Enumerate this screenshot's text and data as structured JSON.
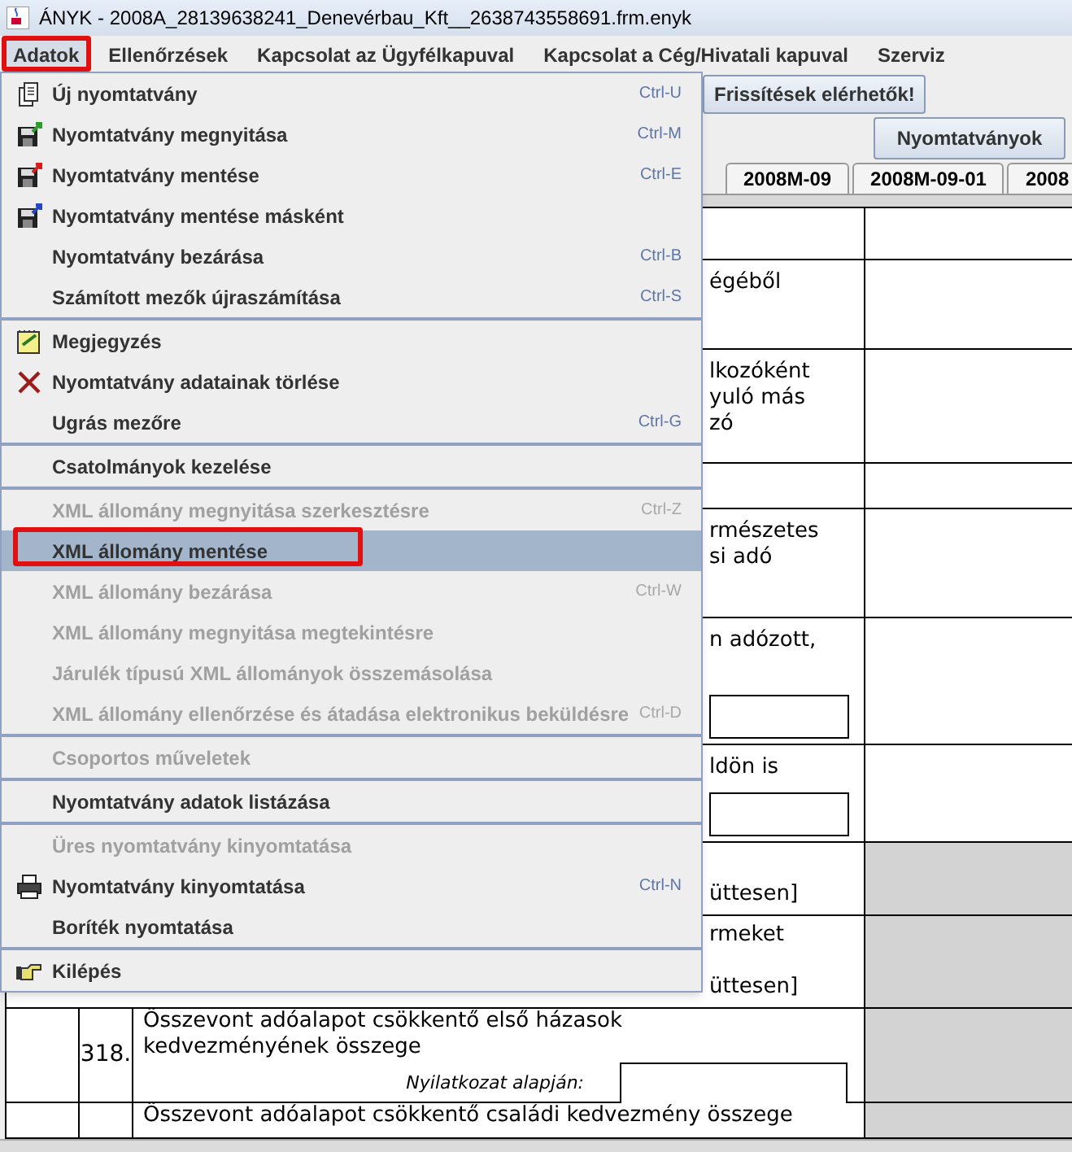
{
  "window": {
    "title": "ÁNYK - 2008A_28139638241_Denevérbau_Kft__2638743558691.frm.enyk"
  },
  "menu_bar": [
    {
      "label": "Adatok",
      "selected": true,
      "marked": true
    },
    {
      "label": "Ellenőrzések",
      "selected": false,
      "marked": false
    },
    {
      "label": "Kapcsolat az Ügyfélkapuval",
      "selected": false,
      "marked": false
    },
    {
      "label": "Kapcsolat a Cég/Hivatali kapuval",
      "selected": false,
      "marked": false
    },
    {
      "label": "Szerviz",
      "selected": false,
      "marked": false
    }
  ],
  "menu": {
    "groups": [
      {
        "items": [
          {
            "label": "Új nyomtatvány",
            "shortcut": "Ctrl-U",
            "kind": "new",
            "disabled": false,
            "selected": false,
            "marked": false
          },
          {
            "label": "Nyomtatvány megnyitása",
            "shortcut": "Ctrl-M",
            "kind": "open",
            "disabled": false,
            "selected": false,
            "marked": false
          },
          {
            "label": "Nyomtatvány mentése",
            "shortcut": "Ctrl-E",
            "kind": "save",
            "disabled": false,
            "selected": false,
            "marked": false
          },
          {
            "label": "Nyomtatvány mentése másként",
            "kind": "saveas",
            "disabled": false,
            "selected": false,
            "marked": false
          },
          {
            "label": "Nyomtatvány bezárása",
            "shortcut": "Ctrl-B",
            "disabled": false,
            "selected": false,
            "marked": false
          },
          {
            "label": "Számított mezők újraszámítása",
            "shortcut": "Ctrl-S",
            "disabled": false,
            "selected": false,
            "marked": false
          }
        ]
      },
      {
        "items": [
          {
            "label": "Megjegyzés",
            "kind": "note",
            "disabled": false,
            "selected": false,
            "marked": false
          },
          {
            "label": "Nyomtatvány adatainak törlése",
            "kind": "delete",
            "disabled": false,
            "selected": false,
            "marked": false
          },
          {
            "label": "Ugrás mezőre",
            "shortcut": "Ctrl-G",
            "disabled": false,
            "selected": false,
            "marked": false
          }
        ]
      },
      {
        "items": [
          {
            "label": "Csatolmányok kezelése",
            "disabled": false,
            "selected": false,
            "marked": false
          }
        ]
      },
      {
        "items": [
          {
            "label": "XML állomány megnyitása szerkesztésre",
            "shortcut": "Ctrl-Z",
            "disabled": true,
            "selected": false,
            "marked": false
          },
          {
            "label": "XML állomány mentése",
            "disabled": false,
            "selected": true,
            "marked": true
          },
          {
            "label": "XML állomány bezárása",
            "shortcut": "Ctrl-W",
            "disabled": true,
            "selected": false,
            "marked": false
          },
          {
            "label": "XML állomány megnyitása megtekintésre",
            "disabled": true,
            "selected": false,
            "marked": false
          },
          {
            "label": "Járulék típusú XML állományok összemásolása",
            "disabled": true,
            "selected": false,
            "marked": false
          },
          {
            "label": "XML állomány ellenőrzése és átadása elektronikus beküldésre",
            "shortcut": "Ctrl-D",
            "disabled": true,
            "selected": false,
            "marked": false
          }
        ]
      },
      {
        "items": [
          {
            "label": "Csoportos műveletek",
            "disabled": true,
            "selected": false,
            "marked": false
          }
        ]
      },
      {
        "items": [
          {
            "label": "Nyomtatvány adatok listázása",
            "disabled": false,
            "selected": false,
            "marked": false
          }
        ]
      },
      {
        "items": [
          {
            "label": "Üres nyomtatvány kinyomtatása",
            "disabled": true,
            "selected": false,
            "marked": false
          },
          {
            "label": "Nyomtatvány kinyomtatása",
            "shortcut": "Ctrl-N",
            "kind": "print",
            "disabled": false,
            "selected": false,
            "marked": false
          },
          {
            "label": "Boríték nyomtatása",
            "disabled": false,
            "selected": false,
            "marked": false
          }
        ]
      },
      {
        "items": [
          {
            "label": "Kilépés",
            "kind": "exit",
            "disabled": false,
            "selected": false,
            "marked": false
          }
        ]
      }
    ]
  },
  "toolbar": {
    "update_button": "Frissítések elérhetők!",
    "forms_button": "Nyomtatványok"
  },
  "tabs": [
    {
      "label": "2008M-09"
    },
    {
      "label": "2008M-09-01"
    },
    {
      "label": "2008"
    }
  ],
  "form": {
    "rows": [
      {
        "kind": "fragment",
        "shaded": false,
        "has_input": false
      },
      {
        "kind": "fragment",
        "lines": [
          "égéből"
        ],
        "shaded": false,
        "has_input": false
      },
      {
        "kind": "fragment",
        "lines": [
          "lkozóként",
          "yuló más",
          "zó"
        ],
        "shaded": false,
        "has_input": false
      },
      {
        "kind": "fragment",
        "shaded": false,
        "has_input": false
      },
      {
        "kind": "fragment",
        "lines": [
          "rmészetes",
          "si adó"
        ],
        "shaded": false,
        "has_input": false
      },
      {
        "kind": "fragment",
        "lines": [
          "n adózott,"
        ],
        "shaded": false,
        "has_input": true
      },
      {
        "kind": "fragment",
        "lines": [
          "ldön is"
        ],
        "shaded": false,
        "has_input": true
      },
      {
        "kind": "fragment",
        "lines": [
          "üttesen]"
        ],
        "shaded": true,
        "has_input": false
      },
      {
        "kind": "fragment",
        "lines": [
          "rmeket",
          "üttesen]"
        ],
        "shaded": true,
        "has_input": false
      },
      {
        "kind": "item",
        "number": "318.",
        "lines": [
          "Összevont adóalapot csökkentő első házasok",
          "kedvezményének összege"
        ],
        "input_label": "Nyilatkozat alapján:",
        "shaded": true,
        "has_input": true
      },
      {
        "kind": "item",
        "lines": [
          "Összevont adóalapot csökkentő családi kedvezmény összege"
        ],
        "shaded": true,
        "has_input": false
      }
    ]
  }
}
